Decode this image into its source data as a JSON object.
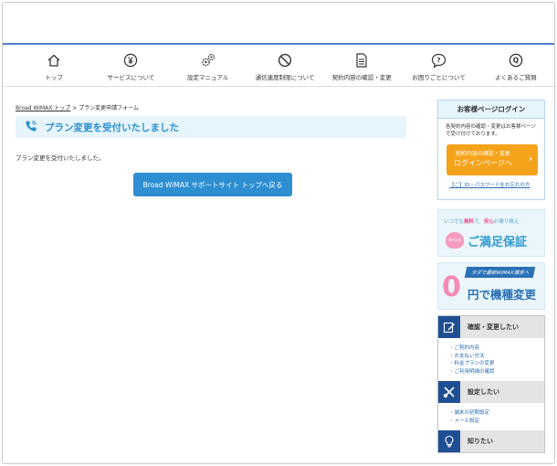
{
  "nav": {
    "items": [
      {
        "label": "トップ",
        "icon": "home-icon"
      },
      {
        "label": "サービスについて",
        "icon": "yen-icon"
      },
      {
        "label": "設定マニュアル",
        "icon": "gears-icon"
      },
      {
        "label": "通信速度制限について",
        "icon": "prohibited-icon"
      },
      {
        "label": "契約内容の確認・変更",
        "icon": "document-icon"
      },
      {
        "label": "お困りごとについて",
        "icon": "question-bubble-icon"
      },
      {
        "label": "よくあるご質問",
        "icon": "q-circle-icon"
      }
    ]
  },
  "breadcrumb": {
    "home": "Broad WiMAX トップ",
    "separator": " > ",
    "current": "プラン変更申請フォーム"
  },
  "main": {
    "title": "プラン変更を受付いたしました",
    "body": "プラン変更を受付いたしました。",
    "back_button": "Broad WiMAX サポートサイト トップへ戻る",
    "title_icon": "phone-icon"
  },
  "sidebar": {
    "login": {
      "heading": "お客様ページログイン",
      "desc": "各契約内容の確認・変更はお客様ページで受け付けております。",
      "button_line1": "契約内容の確認・変更",
      "button_line2": "ログインページへ",
      "button_arrow": "›",
      "forgot": "【ご】ID・パスワードをお忘れの方"
    },
    "banner_satisfaction": {
      "line_prefix": "いつでも",
      "free": "無料",
      "line_mid": "で、",
      "anshin": "安心",
      "line_suffix": "お乗り換え",
      "badge": "Broad",
      "main": "ご満足保証"
    },
    "banner_device": {
      "tag": "タダで最新WiMAX端末へ",
      "zero": "0",
      "main": "円で機種変更"
    },
    "menus": [
      {
        "title": "確認・変更したい",
        "icon": "edit-icon",
        "items": [
          "ご契約内容",
          "お支払い方法",
          "料金プランの変更",
          "ご利用明細の確認"
        ]
      },
      {
        "title": "設定したい",
        "icon": "tools-icon",
        "items": [
          "端末の初期設定",
          "メール設定"
        ]
      },
      {
        "title": "知りたい",
        "icon": "lightbulb-icon",
        "items": []
      }
    ]
  },
  "colors": {
    "accent": "#2d8fd2",
    "title_bg": "#e6f4fb",
    "orange": "#f5a31a",
    "navy": "#1f4f93",
    "nav_line": "#4f7fd0"
  }
}
